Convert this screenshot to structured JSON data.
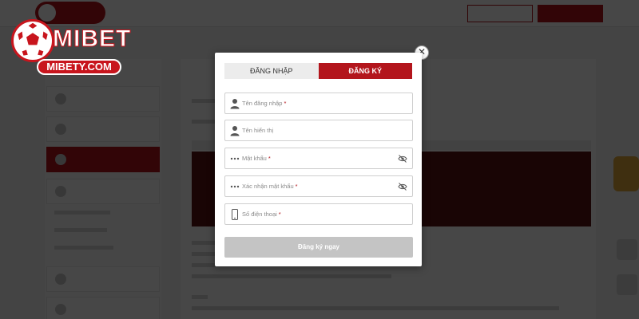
{
  "brand": {
    "name": "MIBET",
    "domain": "MIBETY.COM",
    "accent_color": "#c8151d"
  },
  "modal": {
    "close_icon": "close-icon",
    "tabs": {
      "login": "ĐĂNG NHẬP",
      "register": "ĐĂNG KÝ"
    },
    "active_tab": "register",
    "fields": {
      "username": {
        "placeholder": "Tên đăng nhập",
        "required": "*",
        "icon": "user-icon"
      },
      "display_name": {
        "placeholder": "Tên hiển thị",
        "required": "",
        "icon": "user-icon"
      },
      "password": {
        "placeholder": "Mật khẩu",
        "required": "*",
        "icon": "password-dots-icon",
        "toggle_icon": "eye-off-icon"
      },
      "confirm_password": {
        "placeholder": "Xác nhận mật khẩu",
        "required": "*",
        "icon": "password-dots-icon",
        "toggle_icon": "eye-off-icon"
      },
      "phone": {
        "placeholder": "Số điện thoại",
        "required": "*",
        "icon": "phone-icon"
      }
    },
    "submit_label": "Đăng ký ngay",
    "submit_color": "#c4c4c4",
    "active_tab_color": "#b3151c"
  }
}
